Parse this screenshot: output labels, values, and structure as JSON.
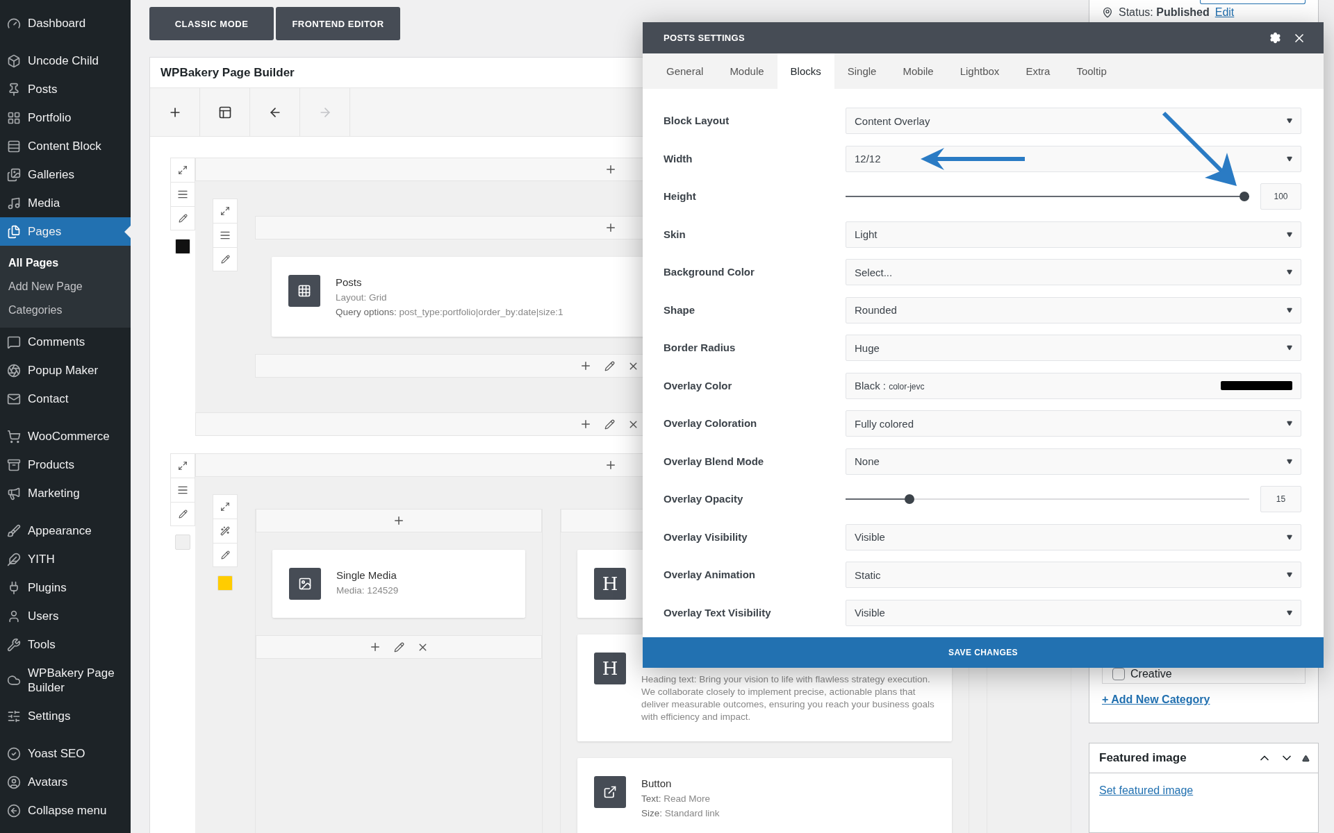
{
  "sidebar": {
    "groups": [
      [
        {
          "label": "Dashboard",
          "selected": false
        }
      ],
      [
        {
          "label": "Uncode Child",
          "selected": false
        },
        {
          "label": "Posts",
          "selected": false
        },
        {
          "label": "Portfolio",
          "selected": false
        },
        {
          "label": "Content Block",
          "selected": false
        },
        {
          "label": "Galleries",
          "selected": false
        },
        {
          "label": "Media",
          "selected": false
        },
        {
          "label": "Pages",
          "selected": true,
          "children": [
            {
              "label": "All Pages",
              "selected": true
            },
            {
              "label": "Add New Page",
              "selected": false
            },
            {
              "label": "Categories",
              "selected": false
            }
          ]
        },
        {
          "label": "Comments",
          "selected": false
        },
        {
          "label": "Popup Maker",
          "selected": false
        },
        {
          "label": "Contact",
          "selected": false
        }
      ],
      [
        {
          "label": "WooCommerce",
          "selected": false
        },
        {
          "label": "Products",
          "selected": false
        },
        {
          "label": "Marketing",
          "selected": false
        }
      ],
      [
        {
          "label": "Appearance",
          "selected": false
        },
        {
          "label": "YITH",
          "selected": false
        },
        {
          "label": "Plugins",
          "selected": false
        },
        {
          "label": "Users",
          "selected": false
        },
        {
          "label": "Tools",
          "selected": false
        },
        {
          "label": "WPBakery Page Builder",
          "selected": false
        },
        {
          "label": "Settings",
          "selected": false
        }
      ],
      [
        {
          "label": "Yoast SEO",
          "selected": false
        },
        {
          "label": "Avatars",
          "selected": false
        },
        {
          "label": "Collapse menu",
          "selected": false
        }
      ]
    ]
  },
  "mode_buttons": [
    "CLASSIC MODE",
    "FRONTEND EDITOR"
  ],
  "builder": {
    "title": "WPBakery Page Builder",
    "rows": [
      {
        "color": "#111111",
        "columns": [
          [
            {
              "title": "Posts",
              "lines": [
                "Layout: Grid",
                "**Query options:** post_type:portfolio|order_by:date|size:1"
              ]
            }
          ]
        ]
      },
      {
        "color": "#f0f0f0",
        "inner_row": {
          "color": "#ffcc00"
        },
        "columns": [
          [
            {
              "title": "Single Media",
              "lines": [
                "Media: 124529"
              ]
            }
          ],
          [
            {
              "icon_letter": "H"
            },
            {
              "icon_letter": "H",
              "lines": [
                "Heading text: Bring your vision to life with flawless strategy execution. We collaborate closely to implement precise, actionable plans that deliver measurable outcomes, ensuring you reach your business goals with efficiency and impact."
              ]
            },
            {
              "title": "Button",
              "lines": [
                "**Text:** Read More",
                "**Size:** Standard link"
              ]
            }
          ],
          []
        ]
      }
    ]
  },
  "side_panel": {
    "status_label": "Status:",
    "status_value": "Published",
    "status_link": "Edit",
    "category": {
      "label": "Creative",
      "checked": false
    },
    "add_category": "+ Add New Category",
    "featured": {
      "title": "Featured image",
      "link": "Set featured image"
    }
  },
  "modal": {
    "title": "POSTS SETTINGS",
    "tabs": [
      {
        "label": "General",
        "selected": false
      },
      {
        "label": "Module",
        "selected": false
      },
      {
        "label": "Blocks",
        "selected": true
      },
      {
        "label": "Single",
        "selected": false
      },
      {
        "label": "Mobile",
        "selected": false
      },
      {
        "label": "Lightbox",
        "selected": false
      },
      {
        "label": "Extra",
        "selected": false
      },
      {
        "label": "Tooltip",
        "selected": false
      }
    ],
    "fields": [
      {
        "label": "Block Layout",
        "kind": "select",
        "value": "Content Overlay"
      },
      {
        "label": "Width",
        "kind": "select",
        "value": "12/12"
      },
      {
        "label": "Height",
        "kind": "slider",
        "level": 1,
        "reading": "100"
      },
      {
        "label": "Skin",
        "kind": "select",
        "value": "Light"
      },
      {
        "label": "Background Color",
        "kind": "select",
        "value": "Select..."
      },
      {
        "label": "Shape",
        "kind": "select",
        "value": "Rounded"
      },
      {
        "label": "Border Radius",
        "kind": "select",
        "value": "Huge"
      },
      {
        "label": "Overlay Color",
        "kind": "color",
        "value": "Black :",
        "note": "color-jevc",
        "color": "#000000"
      },
      {
        "label": "Overlay Coloration",
        "kind": "select",
        "value": "Fully colored"
      },
      {
        "label": "Overlay Blend Mode",
        "kind": "select",
        "value": "None"
      },
      {
        "label": "Overlay Opacity",
        "kind": "slider",
        "level": 0.15,
        "reading": "15"
      },
      {
        "label": "Overlay Visibility",
        "kind": "select",
        "value": "Visible"
      },
      {
        "label": "Overlay Animation",
        "kind": "select",
        "value": "Static"
      },
      {
        "label": "Overlay Text Visibility",
        "kind": "select",
        "value": "Visible"
      }
    ],
    "save": "SAVE CHANGES"
  }
}
